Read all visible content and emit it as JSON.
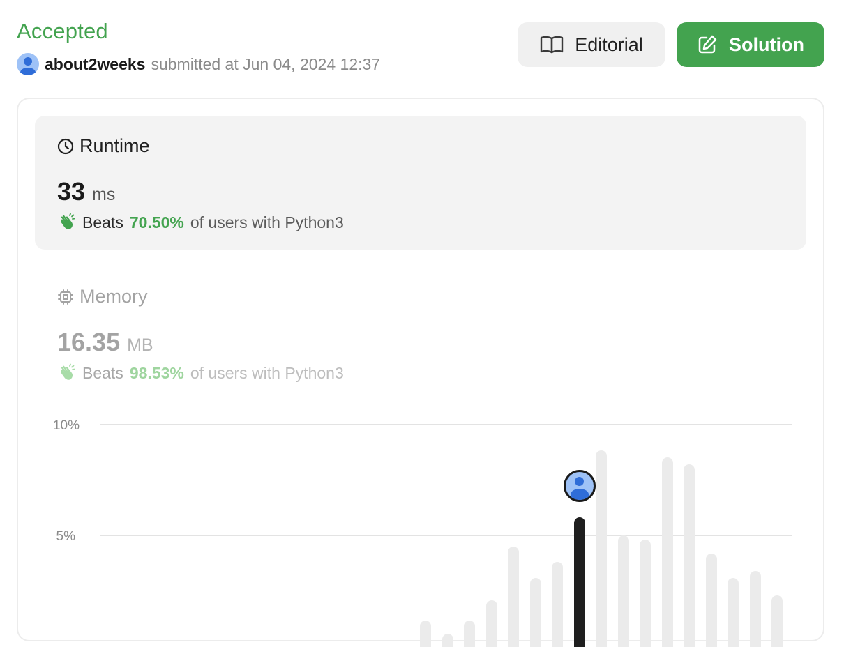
{
  "header": {
    "status": "Accepted",
    "username": "about2weeks",
    "submitted_text": "submitted at Jun 04, 2024 12:37"
  },
  "buttons": {
    "editorial_label": "Editorial",
    "solution_label": "Solution"
  },
  "runtime": {
    "title": "Runtime",
    "value": "33",
    "unit": "ms",
    "beats_prefix": "Beats",
    "beats_percent": "70.50%",
    "beats_suffix": "of users with Python3"
  },
  "memory": {
    "title": "Memory",
    "value": "16.35",
    "unit": "MB",
    "beats_prefix": "Beats",
    "beats_percent": "98.53%",
    "beats_suffix": "of users with Python3"
  },
  "colors": {
    "accent_green": "#43a34f",
    "muted_green": "#9fd59f",
    "bar_gray": "#ebebeb",
    "bar_active": "#1f1f1f"
  },
  "chart_data": {
    "type": "bar",
    "y_ticks": [
      "10%",
      "5%"
    ],
    "ylim": [
      0,
      10
    ],
    "values": [
      1.2,
      0.6,
      1.2,
      2.1,
      4.5,
      3.1,
      3.8,
      5.8,
      8.8,
      5.0,
      4.8,
      8.5,
      8.2,
      4.2,
      3.1,
      3.4,
      2.3
    ],
    "highlight_index": 7
  }
}
